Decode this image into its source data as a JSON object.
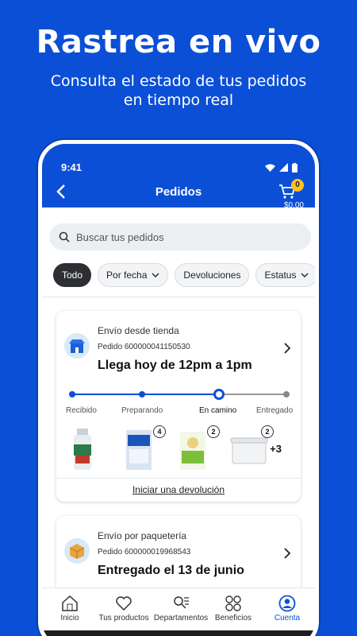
{
  "hero": {
    "title": "Rastrea en vivo",
    "subtitle": "Consulta el estado de tus pedidos en tiempo real"
  },
  "status_bar": {
    "time": "9:41"
  },
  "header": {
    "title": "Pedidos",
    "cart_count": "0",
    "cart_total": "$0.00"
  },
  "search": {
    "placeholder": "Buscar tus pedidos"
  },
  "filters": [
    {
      "label": "Todo",
      "active": true
    },
    {
      "label": "Por fecha",
      "dropdown": true
    },
    {
      "label": "Devoluciones"
    },
    {
      "label": "Estatus",
      "dropdown": true
    }
  ],
  "orders": [
    {
      "type": "Envío desde tienda",
      "order_number": "Pedido 600000041150530",
      "eta": "Llega hoy de 12pm a 1pm",
      "steps": [
        "Recibido",
        "Preparando",
        "En camino",
        "Entregado"
      ],
      "current_step": "En camino",
      "items": [
        {
          "icon": "cleaner-bottle-icon",
          "qty": null
        },
        {
          "icon": "detergent-bag-icon",
          "qty": "4"
        },
        {
          "icon": "flour-bag-icon",
          "qty": "2"
        },
        {
          "icon": "storage-box-icon",
          "qty": "2"
        }
      ],
      "more_items": "+3",
      "action": "Iniciar una devolución"
    },
    {
      "type": "Envío por paquetería",
      "order_number": "Pedido 600000019968543",
      "eta": "Entregado el 13 de junio"
    }
  ],
  "tabs": [
    {
      "label": "Inicio",
      "icon": "home-icon"
    },
    {
      "label": "Tus productos",
      "icon": "heart-icon"
    },
    {
      "label": "Departamentos",
      "icon": "search-list-icon"
    },
    {
      "label": "Beneficios",
      "icon": "grid-icon"
    },
    {
      "label": "Cuenta",
      "icon": "account-icon",
      "active": true
    }
  ],
  "colors": {
    "brand": "#0b4fd6",
    "accent": "#ffc220"
  }
}
